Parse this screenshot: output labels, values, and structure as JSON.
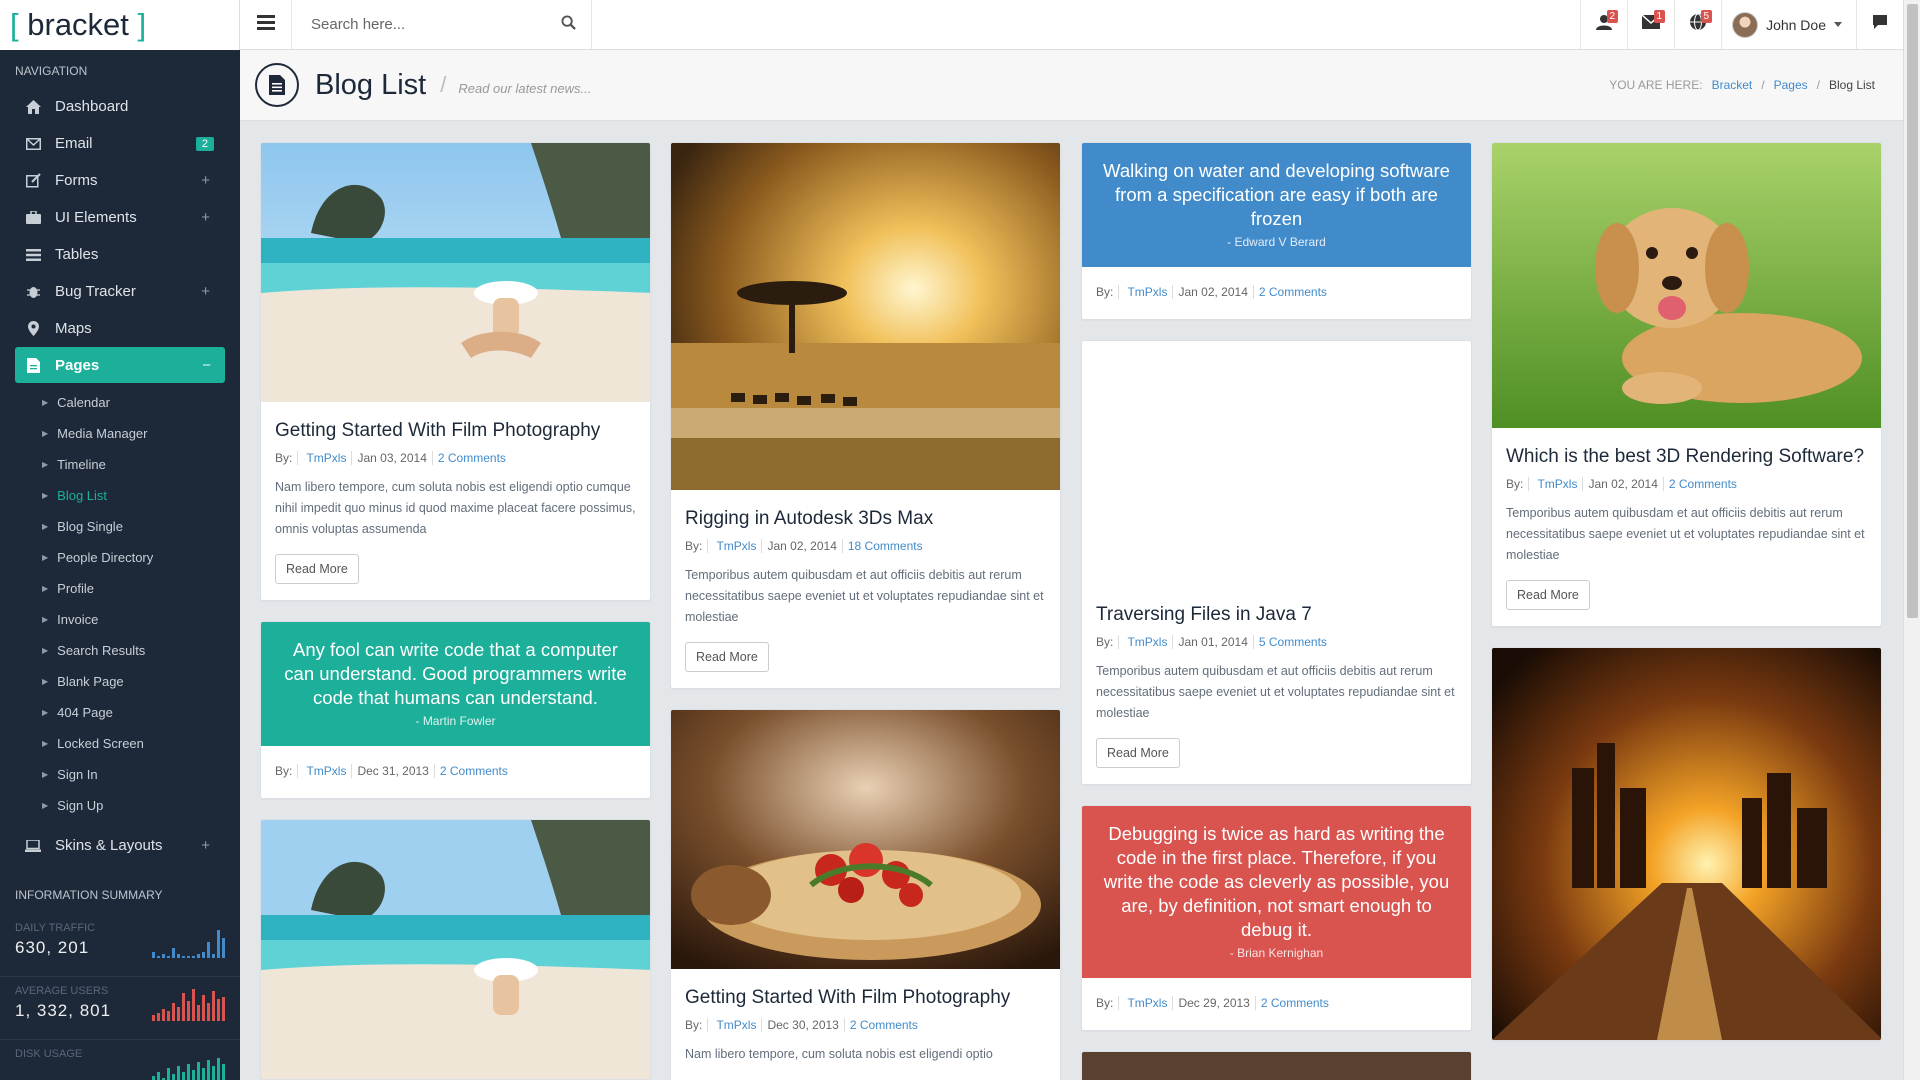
{
  "app": {
    "logo_open": "[",
    "logo_text": "bracket",
    "logo_close": "]"
  },
  "search": {
    "placeholder": "Search here..."
  },
  "header": {
    "badges": {
      "users": "2",
      "messages": "1",
      "globe": "5"
    },
    "user_name": "John Doe"
  },
  "sidebar": {
    "nav_title": "Navigation",
    "items": [
      {
        "label": "Dashboard",
        "icon": "home-icon"
      },
      {
        "label": "Email",
        "icon": "envelope-icon",
        "badge": "2"
      },
      {
        "label": "Forms",
        "icon": "edit-icon",
        "expand": "+"
      },
      {
        "label": "UI Elements",
        "icon": "suitcase-icon",
        "expand": "+"
      },
      {
        "label": "Tables",
        "icon": "list-icon"
      },
      {
        "label": "Bug Tracker",
        "icon": "bug-icon",
        "expand": "+"
      },
      {
        "label": "Maps",
        "icon": "map-marker-icon"
      },
      {
        "label": "Pages",
        "icon": "file-icon",
        "expand": "−"
      }
    ],
    "sub_items": [
      "Calendar",
      "Media Manager",
      "Timeline",
      "Blog List",
      "Blog Single",
      "People Directory",
      "Profile",
      "Invoice",
      "Search Results",
      "Blank Page",
      "404 Page",
      "Locked Screen",
      "Sign In",
      "Sign Up"
    ],
    "skins": {
      "label": "Skins & Layouts",
      "icon": "laptop-icon",
      "expand": "+"
    },
    "info_title": "Information Summary",
    "stats": [
      {
        "label": "Daily Traffic",
        "value": "630, 201",
        "color": "#428bca"
      },
      {
        "label": "Average Users",
        "value": "1, 332, 801",
        "color": "#d9534f"
      },
      {
        "label": "Disk Usage",
        "value": "",
        "color": "#1caf9a"
      }
    ]
  },
  "page": {
    "title": "Blog List",
    "subtitle": "Read our latest news...",
    "breadcrumb": {
      "label": "You are here:",
      "items": [
        "Bracket",
        "Pages",
        "Blog List"
      ]
    }
  },
  "colors": {
    "accent": "#1caf9a",
    "sidebar": "#1d2939",
    "quote_blue": "#428bca",
    "quote_red": "#d9534f",
    "link": "#428bca"
  },
  "posts": {
    "c1p1": {
      "title": "Getting Started With Film Photography",
      "by": "By:",
      "author": "TmPxls",
      "date": "Jan 03, 2014",
      "comments": "2 Comments",
      "excerpt": "Nam libero tempore, cum soluta nobis est eligendi optio cumque nihil impedit quo minus id quod maxime placeat facere possimus, omnis voluptas assumenda",
      "button": "Read More"
    },
    "c1q1": {
      "quote": "Any fool can write code that a computer can understand. Good programmers write code that humans can understand.",
      "author_line": "- Martin Fowler",
      "by": "By:",
      "author": "TmPxls",
      "date": "Dec 31, 2013",
      "comments": "2 Comments"
    },
    "c2p1": {
      "title": "Rigging in Autodesk 3Ds Max",
      "by": "By:",
      "author": "TmPxls",
      "date": "Jan 02, 2014",
      "comments": "18 Comments",
      "excerpt": "Temporibus autem quibusdam et aut officiis debitis aut rerum necessitatibus saepe eveniet ut et voluptates repudiandae sint et molestiae",
      "button": "Read More"
    },
    "c2p2": {
      "title": "Getting Started With Film Photography",
      "by": "By:",
      "author": "TmPxls",
      "date": "Dec 30, 2013",
      "comments": "2 Comments",
      "excerpt": "Nam libero tempore, cum soluta nobis est eligendi optio"
    },
    "c3q1": {
      "quote": "Walking on water and developing software from a specification are easy if both are frozen",
      "author_line": "- Edward V Berard",
      "by": "By:",
      "author": "TmPxls",
      "date": "Jan 02, 2014",
      "comments": "2 Comments"
    },
    "c3p1": {
      "title": "Traversing Files in Java 7",
      "by": "By:",
      "author": "TmPxls",
      "date": "Jan 01, 2014",
      "comments": "5 Comments",
      "excerpt": "Temporibus autem quibusdam et aut officiis debitis aut rerum necessitatibus saepe eveniet ut et voluptates repudiandae sint et molestiae",
      "button": "Read More"
    },
    "c3q2": {
      "quote": "Debugging is twice as hard as writing the code in the first place. Therefore, if you write the code as cleverly as possible, you are, by definition, not smart enough to debug it.",
      "author_line": "- Brian Kernighan",
      "by": "By:",
      "author": "TmPxls",
      "date": "Dec 29, 2013",
      "comments": "2 Comments"
    },
    "c4p1": {
      "title": "Which is the best 3D Rendering Software?",
      "by": "By:",
      "author": "TmPxls",
      "date": "Jan 02, 2014",
      "comments": "2 Comments",
      "excerpt": "Temporibus autem quibusdam et aut officiis debitis aut rerum necessitatibus saepe eveniet ut et voluptates repudiandae sint et molestiae",
      "button": "Read More"
    }
  }
}
